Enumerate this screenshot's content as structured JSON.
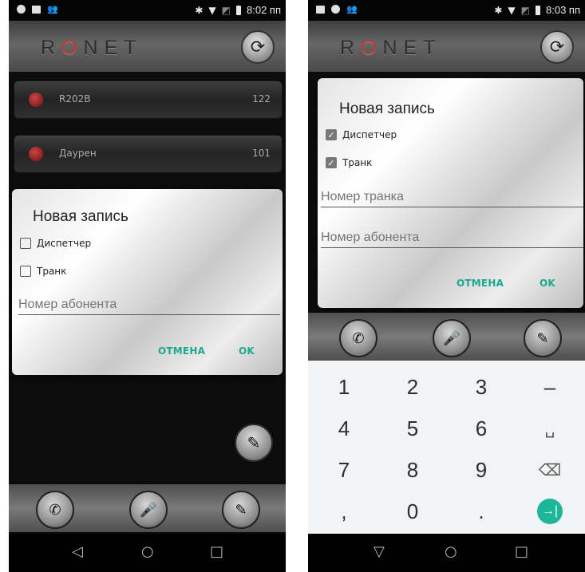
{
  "left": {
    "status": {
      "time": "8:02 пп"
    },
    "app": {
      "logo_pre": "R",
      "logo_o": "O",
      "logo_post": "NET"
    },
    "contacts": [
      {
        "name": "R202B",
        "number": "122"
      },
      {
        "name": "Даурен",
        "number": "101"
      }
    ],
    "dialog": {
      "title": "Новая запись",
      "dispatcher_label": "Диспетчер",
      "dispatcher_checked": false,
      "trunk_label": "Транк",
      "trunk_checked": false,
      "subscriber_placeholder": "Номер абонента",
      "cancel": "ОТМЕНА",
      "ok": "OK"
    }
  },
  "right": {
    "status": {
      "time": "8:03 пп"
    },
    "app": {
      "logo_pre": "R",
      "logo_o": "O",
      "logo_post": "NET"
    },
    "dialog": {
      "title": "Новая запись",
      "dispatcher_label": "Диспетчер",
      "dispatcher_checked": true,
      "trunk_label": "Транк",
      "trunk_checked": true,
      "trunk_placeholder": "Номер транка",
      "subscriber_placeholder": "Номер абонента",
      "cancel": "ОТМЕНА",
      "ok": "OK"
    },
    "keypad": {
      "row1": [
        "1",
        "2",
        "3",
        "–"
      ],
      "row2": [
        "4",
        "5",
        "6",
        "␣"
      ],
      "row3": [
        "7",
        "8",
        "9",
        "⌫"
      ],
      "row4": [
        ",",
        "0",
        ".",
        "→|"
      ]
    }
  },
  "icons": {
    "status": [
      "record-icon",
      "image-icon",
      "people-icon",
      "bluetooth-icon",
      "wifi-icon",
      "no-sim-icon",
      "battery-icon"
    ],
    "app": [
      "refresh-icon",
      "edit-fab-icon"
    ],
    "toolbar": [
      "phone-icon",
      "microphone-icon",
      "edit-icon"
    ],
    "nav": [
      "back-icon",
      "home-icon",
      "recents-icon"
    ]
  }
}
